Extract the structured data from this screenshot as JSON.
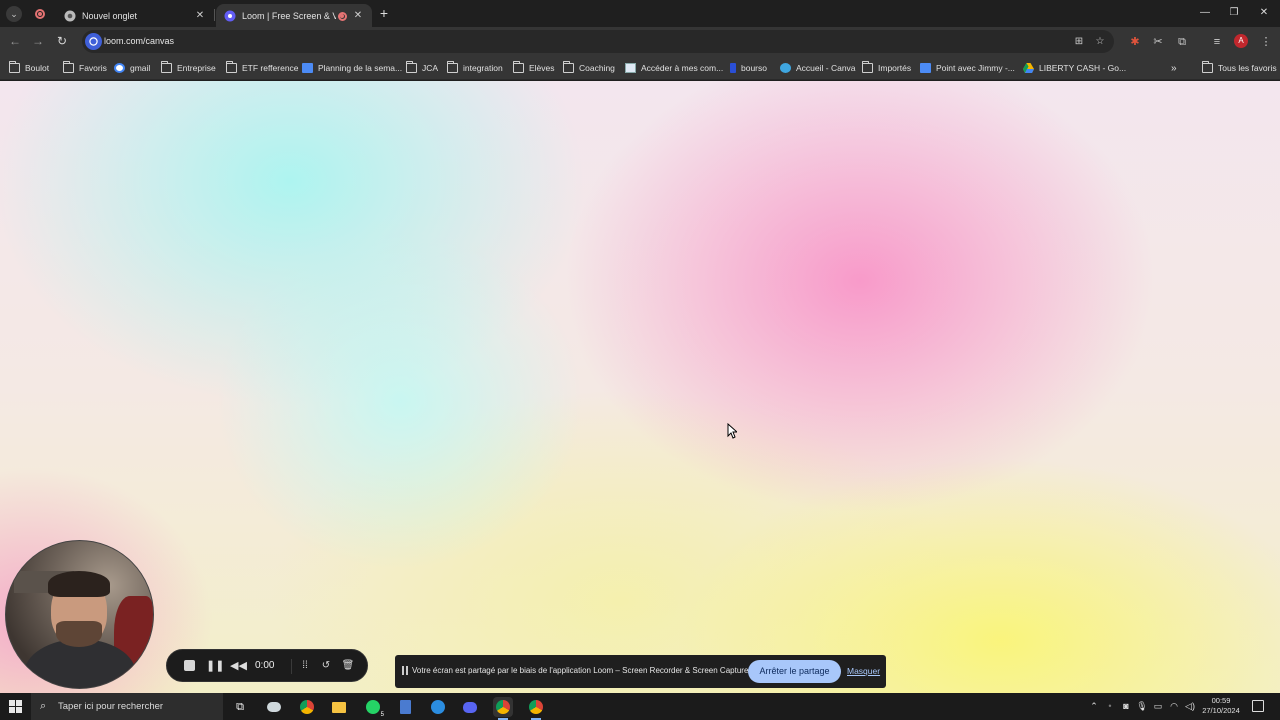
{
  "browser": {
    "tabs": [
      {
        "title": "Nouvel onglet",
        "favicon": "chrome-icon"
      },
      {
        "title": "Loom | Free Screen & Video",
        "favicon": "loom-icon",
        "recording": true
      }
    ],
    "url": "loom.com/canvas",
    "profile_initial": "A",
    "bookmarks": [
      {
        "label": "Boulot",
        "icon": "folder-icon"
      },
      {
        "label": "Favoris",
        "icon": "folder-icon"
      },
      {
        "label": "gmail",
        "icon": "google-icon"
      },
      {
        "label": "Entreprise",
        "icon": "folder-icon"
      },
      {
        "label": "ETF refference",
        "icon": "folder-icon"
      },
      {
        "label": "Planning de la sema...",
        "icon": "doc-icon"
      },
      {
        "label": "JCA",
        "icon": "folder-icon"
      },
      {
        "label": "integration",
        "icon": "folder-icon"
      },
      {
        "label": "Elèves",
        "icon": "folder-icon"
      },
      {
        "label": "Coaching",
        "icon": "folder-icon"
      },
      {
        "label": "Accéder à mes com...",
        "icon": "site-icon"
      },
      {
        "label": "bourso",
        "icon": "bourso-icon"
      },
      {
        "label": "Accueil - Canva",
        "icon": "canva-icon"
      },
      {
        "label": "Importés",
        "icon": "folder-icon"
      },
      {
        "label": "Point avec Jimmy -...",
        "icon": "doc-icon"
      },
      {
        "label": "LIBERTY CASH - Go...",
        "icon": "drive-icon"
      }
    ],
    "all_bookmarks_label": "Tous les favoris"
  },
  "recorder": {
    "time": "0:00"
  },
  "share_notice": {
    "text": "Votre écran est partagé par le biais de l'application Loom – Screen Recorder & Screen Capture.",
    "stop_label": "Arrêter le partage",
    "hide_label": "Masquer"
  },
  "taskbar": {
    "search_placeholder": "Taper ici pour rechercher",
    "time": "00:59",
    "date": "27/10/2024",
    "whatsapp_badge": "5"
  },
  "colors": {
    "accent_blue": "#a8c7fa",
    "loom_blue": "#3f5fd8",
    "record_red": "#e57373"
  }
}
